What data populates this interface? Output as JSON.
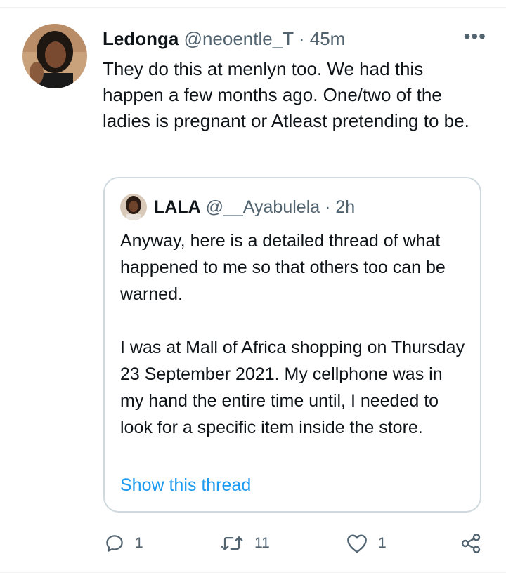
{
  "tweet": {
    "author_name": "Ledonga",
    "handle": "@neoentle_T",
    "separator": "·",
    "time": "45m",
    "more_label": "•••",
    "text": "They do this at menlyn too.   We had this happen a few months ago. One/two of the ladies is pregnant or Atleast pretending to be."
  },
  "quote": {
    "author_name": "LALA",
    "handle": "@__Ayabulela",
    "separator": "·",
    "time": "2h",
    "paragraph1": "Anyway, here is a detailed thread of what happened to me so that others too can be warned.",
    "paragraph2": "I was at Mall of Africa shopping on Thursday 23 September 2021. My cellphone was in my hand the entire time until, I needed to look for a specific item inside the store.",
    "show_thread": "Show this thread"
  },
  "actions": {
    "reply_count": "1",
    "retweet_count": "11",
    "like_count": "1",
    "icons": [
      "reply-icon",
      "retweet-icon",
      "like-icon",
      "share-icon"
    ]
  },
  "colors": {
    "text": "#0f1419",
    "secondary": "#536471",
    "link": "#1d9bf0",
    "border": "#cfd9de"
  }
}
